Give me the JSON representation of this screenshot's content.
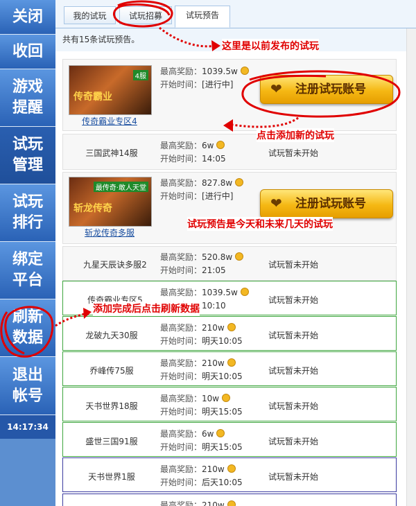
{
  "sidebar": {
    "items": [
      {
        "label": "关闭",
        "active": false
      },
      {
        "label": "收回",
        "active": false
      },
      {
        "label": "游戏提醒",
        "active": false
      },
      {
        "label": "试玩管理",
        "active": true
      },
      {
        "label": "试玩排行",
        "active": false
      },
      {
        "label": "绑定平台",
        "active": false
      },
      {
        "label": "刷新数据",
        "active": false
      },
      {
        "label": "退出帐号",
        "active": false
      }
    ],
    "clock": "14:17:34"
  },
  "tabs": [
    {
      "label": "我的试玩",
      "active": false
    },
    {
      "label": "试玩招募",
      "active": false
    },
    {
      "label": "试玩预告",
      "active": true
    }
  ],
  "summary": "共有15条试玩预告。",
  "labels": {
    "reward": "最高奖励：",
    "start": "开始时间："
  },
  "register_button": "注册试玩账号",
  "rows": [
    {
      "name": "传奇霸业专区4",
      "reward": "1039.5w",
      "start": "[进行中]",
      "status": "",
      "thumb_title": "传奇霸业",
      "thumb_tag": "4服"
    },
    {
      "name": "三国武神14服",
      "reward": "6w",
      "start": "14:05",
      "status": "试玩暂未开始"
    },
    {
      "name": "斩龙传奇多服",
      "reward": "827.8w",
      "start": "[进行中]",
      "status": "",
      "thumb_title": "斩龙传奇",
      "thumb_tag": "最传奇·敢人天堂"
    },
    {
      "name": "九星天辰诀多服2",
      "reward": "520.8w",
      "start": "21:05",
      "status": "试玩暂未开始"
    },
    {
      "name": "传奇霸业专区5",
      "reward": "1039.5w",
      "start": "10:10",
      "status": "试玩暂未开始"
    },
    {
      "name": "龙破九天30服",
      "reward": "210w",
      "start": "明天10:05",
      "status": "试玩暂未开始"
    },
    {
      "name": "乔峰传75服",
      "reward": "210w",
      "start": "明天10:05",
      "status": "试玩暂未开始"
    },
    {
      "name": "天书世界18服",
      "reward": "10w",
      "start": "明天15:05",
      "status": "试玩暂未开始"
    },
    {
      "name": "盛世三国91服",
      "reward": "6w",
      "start": "明天15:05",
      "status": "试玩暂未开始"
    },
    {
      "name": "天书世界1服",
      "reward": "210w",
      "start": "后天10:05",
      "status": "试玩暂未开始"
    },
    {
      "name": "",
      "reward": "210w",
      "start": "",
      "status": ""
    }
  ],
  "annotations": {
    "previous": "这里是以前发布的试玩",
    "add_new": "点击添加新的试玩",
    "preview_desc": "试玩预告是今天和未来几天的试玩",
    "refresh": "添加完成后点击刷新数据"
  },
  "colors": {
    "sidebar_blue": "#2a62b6",
    "annotation_red": "#e00000",
    "button_gold": "#f5b814",
    "row_green": "#3ea63e"
  }
}
